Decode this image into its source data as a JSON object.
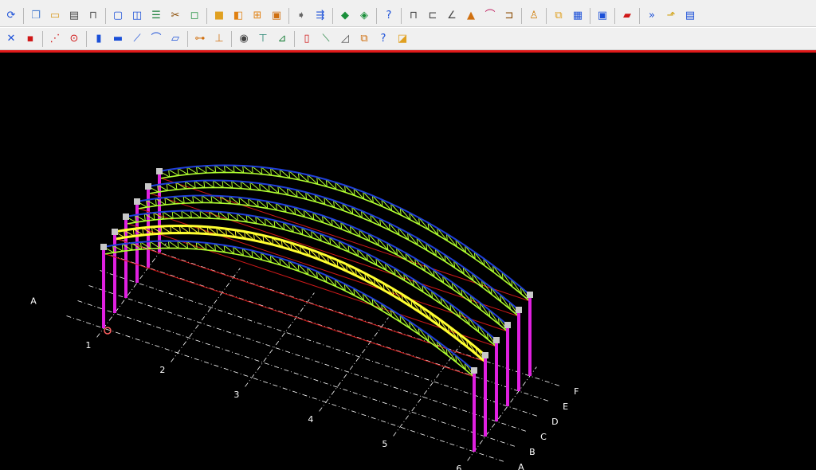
{
  "menubar": {
    "items": []
  },
  "toolbar1": {
    "icons": [
      {
        "name": "refresh-icon",
        "glyph": "⟳",
        "color": "#1a4fd8"
      },
      {
        "sep": true
      },
      {
        "name": "copy-icon",
        "glyph": "❐",
        "color": "#4a7fd0"
      },
      {
        "name": "open-folder-icon",
        "glyph": "▭",
        "color": "#d89a20"
      },
      {
        "name": "print-icon",
        "glyph": "▤",
        "color": "#444"
      },
      {
        "name": "fillet-icon",
        "glyph": "⊓",
        "color": "#555"
      },
      {
        "sep": true
      },
      {
        "name": "rectangle-icon",
        "glyph": "▢",
        "color": "#1a4fd8"
      },
      {
        "name": "window-icon",
        "glyph": "◫",
        "color": "#1a4fd8"
      },
      {
        "name": "layers-icon",
        "glyph": "☰",
        "color": "#1a7f3a"
      },
      {
        "name": "scissors-icon",
        "glyph": "✂",
        "color": "#8a4a00"
      },
      {
        "name": "select-box-icon",
        "glyph": "◻",
        "color": "#1a8f3a"
      },
      {
        "sep": true
      },
      {
        "name": "cube-icon",
        "glyph": "■",
        "color": "#e0a020"
      },
      {
        "name": "stack-icon",
        "glyph": "◧",
        "color": "#e08010"
      },
      {
        "name": "beam-section-icon",
        "glyph": "⊞",
        "color": "#e08010"
      },
      {
        "name": "frame-section-icon",
        "glyph": "▣",
        "color": "#d07010"
      },
      {
        "sep": true
      },
      {
        "name": "arrow-right-icon",
        "glyph": "➧",
        "color": "#666"
      },
      {
        "name": "arrow-merge-icon",
        "glyph": "⇶",
        "color": "#1a4fd8"
      },
      {
        "sep": true
      },
      {
        "name": "node-green-icon",
        "glyph": "◆",
        "color": "#1a8f3a"
      },
      {
        "name": "node-drop-icon",
        "glyph": "◈",
        "color": "#1a8f3a"
      },
      {
        "sep": true
      },
      {
        "name": "query-icon",
        "glyph": "?",
        "color": "#1a4fd8"
      },
      {
        "sep": true
      },
      {
        "name": "column-grid-icon",
        "glyph": "⊓",
        "color": "#444"
      },
      {
        "name": "support-icon",
        "glyph": "⊏",
        "color": "#444"
      },
      {
        "name": "angle-icon",
        "glyph": "∠",
        "color": "#444"
      },
      {
        "name": "load-triangle-icon",
        "glyph": "▲",
        "color": "#d07010"
      },
      {
        "name": "arc-icon",
        "glyph": "⌒",
        "color": "#c02060"
      },
      {
        "name": "portal-icon",
        "glyph": "⊐",
        "color": "#8a4a00"
      },
      {
        "sep": true
      },
      {
        "name": "person-icon",
        "glyph": "♙",
        "color": "#d08010"
      },
      {
        "sep": true
      },
      {
        "name": "overlap-icon",
        "glyph": "⧉",
        "color": "#e0a020"
      },
      {
        "name": "calculator-icon",
        "glyph": "▦",
        "color": "#1a4fd8"
      },
      {
        "sep": true
      },
      {
        "name": "monitor-icon",
        "glyph": "▣",
        "color": "#1a4fd8"
      },
      {
        "sep": true
      },
      {
        "name": "image-icon",
        "glyph": "▰",
        "color": "#d01818"
      },
      {
        "sep": true
      },
      {
        "name": "double-arrow-icon",
        "glyph": "»",
        "color": "#1a4fd8"
      },
      {
        "name": "folder-arrow-icon",
        "glyph": "⬏",
        "color": "#d0a010"
      },
      {
        "name": "report-icon",
        "glyph": "▤",
        "color": "#1a4fd8"
      }
    ]
  },
  "toolbar2": {
    "icons": [
      {
        "name": "delete-x-icon",
        "glyph": "✕",
        "color": "#1a4fd8"
      },
      {
        "name": "red-point-icon",
        "glyph": "▪",
        "color": "#d01818"
      },
      {
        "sep": true
      },
      {
        "name": "dash-line-icon",
        "glyph": "⋰",
        "color": "#d01818"
      },
      {
        "name": "target-circle-icon",
        "glyph": "⊙",
        "color": "#d01818"
      },
      {
        "sep": true
      },
      {
        "name": "column-member-icon",
        "glyph": "▮",
        "color": "#1a4fd8"
      },
      {
        "name": "beam-member-icon",
        "glyph": "▬",
        "color": "#1a4fd8"
      },
      {
        "name": "brace-member-icon",
        "glyph": "⟋",
        "color": "#1a4fd8"
      },
      {
        "name": "curved-member-icon",
        "glyph": "⌒",
        "color": "#1a4fd8"
      },
      {
        "name": "slab-member-icon",
        "glyph": "▱",
        "color": "#1a4fd8"
      },
      {
        "sep": true
      },
      {
        "name": "connection-icon",
        "glyph": "⊶",
        "color": "#d07010"
      },
      {
        "name": "base-support-icon",
        "glyph": "⊥",
        "color": "#d07010"
      },
      {
        "sep": true
      },
      {
        "name": "binoculars-icon",
        "glyph": "◉",
        "color": "#444"
      },
      {
        "name": "table-edit-icon",
        "glyph": "⊤",
        "color": "#1a7f6a"
      },
      {
        "name": "node-arrow-icon",
        "glyph": "⊿",
        "color": "#1a7f3a"
      },
      {
        "sep": true
      },
      {
        "name": "member-red-icon",
        "glyph": "▯",
        "color": "#d01818"
      },
      {
        "name": "diagonal-member-icon",
        "glyph": "⟍",
        "color": "#1a7f3a"
      },
      {
        "name": "slope-icon",
        "glyph": "◿",
        "color": "#555"
      },
      {
        "name": "copy-member-icon",
        "glyph": "⧉",
        "color": "#d07010"
      },
      {
        "name": "query-member-icon",
        "glyph": "?",
        "color": "#1a4fd8"
      },
      {
        "name": "color-block-icon",
        "glyph": "◪",
        "color": "#e0a020"
      }
    ]
  },
  "model": {
    "colors": {
      "grid": "#ffffff",
      "column": "#e020e0",
      "chord": "#2040d8",
      "web": "#b0ff30",
      "selected": "#ffff30",
      "tie": "#cc1818",
      "base": "#ff6060"
    },
    "axis_letters": [
      "A",
      "B",
      "C",
      "D",
      "E",
      "F"
    ],
    "axis_numbers": [
      "1",
      "2",
      "3",
      "4",
      "5",
      "6"
    ],
    "selected_frame": "B"
  }
}
